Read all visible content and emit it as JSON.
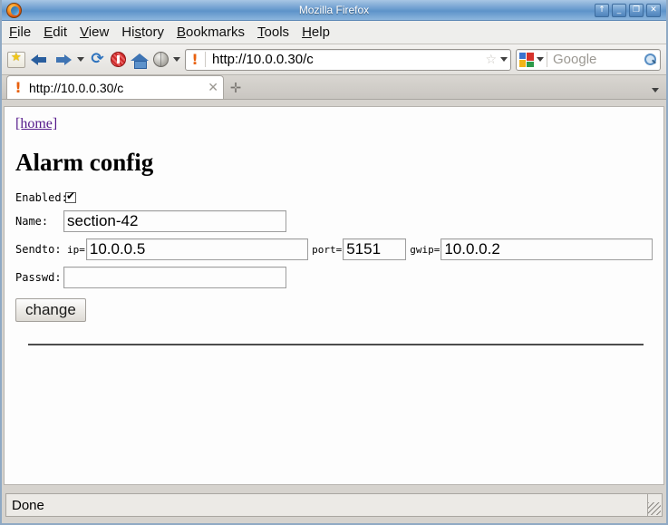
{
  "window": {
    "title": "Mozilla Firefox",
    "logo_icon": "firefox-logo-icon",
    "buttons": [
      {
        "name": "shade-button",
        "glyph": "↑"
      },
      {
        "name": "minimize-button",
        "glyph": "_"
      },
      {
        "name": "maximize-button",
        "glyph": "❐"
      },
      {
        "name": "close-button",
        "glyph": "✕"
      }
    ]
  },
  "menubar": {
    "items": [
      {
        "pre": "",
        "acc": "F",
        "post": "ile"
      },
      {
        "pre": "",
        "acc": "E",
        "post": "dit"
      },
      {
        "pre": "",
        "acc": "V",
        "post": "iew"
      },
      {
        "pre": "Hi",
        "acc": "s",
        "post": "tory"
      },
      {
        "pre": "",
        "acc": "B",
        "post": "ookmarks"
      },
      {
        "pre": "",
        "acc": "T",
        "post": "ools"
      },
      {
        "pre": "",
        "acc": "H",
        "post": "elp"
      }
    ]
  },
  "toolbar": {
    "icons": [
      "bookmark-star-icon",
      "back-arrow-icon",
      "forward-arrow-icon",
      "history-dropdown-icon",
      "reload-icon",
      "stop-icon",
      "home-icon",
      "globe-icon",
      "globe-dropdown-icon"
    ],
    "url": "http://10.0.0.30/c",
    "favicon": "exclamation-favicon",
    "bookmark_star": "☆",
    "url_dropdown": "chevron-down-icon",
    "search_placeholder": "Google",
    "search_engine_icon": "google-icon",
    "search_submit_icon": "magnifier-icon"
  },
  "tabbar": {
    "tab_title": "http://10.0.0.30/c",
    "tab_favicon": "exclamation-favicon",
    "close_glyph": "✕",
    "newtab_glyph": "✛",
    "list_all_tabs": "chevron-down-icon"
  },
  "page": {
    "home_link": "[home]",
    "heading": "Alarm config",
    "labels": {
      "enabled": "Enabled:",
      "name": "Name:",
      "sendto": "Sendto:",
      "passwd": "Passwd:",
      "ip": "ip=",
      "port": "port=",
      "gwip": "gwip="
    },
    "values": {
      "enabled_checked": "true",
      "name": "section-42",
      "ip": "10.0.0.5",
      "port": "5151",
      "gwip": "10.0.0.2",
      "passwd": ""
    },
    "submit_label": "change"
  },
  "statusbar": {
    "text": "Done",
    "grip": "resize-grip-icon"
  },
  "colors": {
    "titlebar_blue": "#6f9fd0",
    "visited_link": "#551a8b",
    "favicon_orange": "#e8610f",
    "chrome_gray": "#d6d3ce"
  }
}
